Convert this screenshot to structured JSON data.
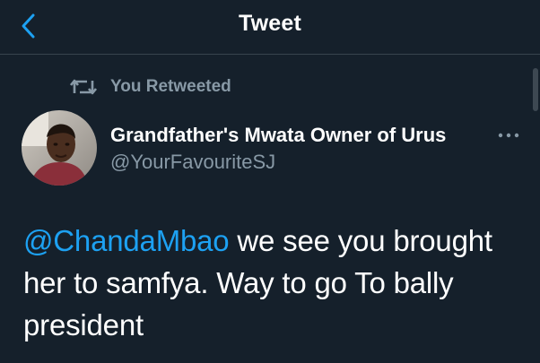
{
  "header": {
    "title": "Tweet",
    "back_icon": "chevron-left-icon",
    "accent_color": "#1da1f2"
  },
  "retweet_context": {
    "icon": "retweet-icon",
    "label": "You Retweeted"
  },
  "tweet": {
    "author": {
      "display_name": "Grandfather's Mwata Owner of Urus",
      "handle": "@YourFavouriteSJ",
      "avatar_icon": "user-avatar"
    },
    "more_icon": "more-options-icon",
    "mention": "@ChandaMbao",
    "body_line1_rest": " we see you brought",
    "body_line2": "her to samfya. Way to go To bally",
    "body_line3": "president"
  },
  "colors": {
    "background": "#15202b",
    "divider": "#38444d",
    "secondary_text": "#8899a6",
    "primary_text": "#ffffff",
    "link": "#1da1f2"
  }
}
